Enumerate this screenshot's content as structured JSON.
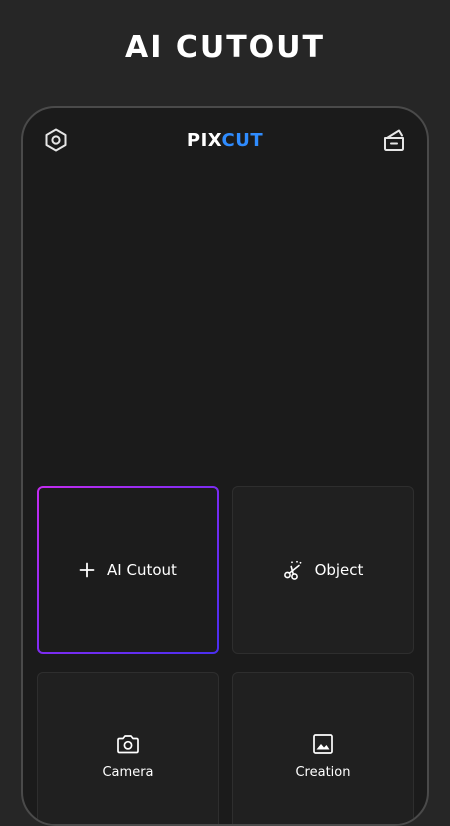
{
  "headline": "AI CUTOUT",
  "app": {
    "logo_left": "PIX",
    "logo_right": "CUT"
  },
  "icons": {
    "settings": "hexagon-settings-icon",
    "cart": "cart-icon",
    "plus": "plus-icon",
    "scissors": "scissors-icon",
    "camera": "camera-icon",
    "image": "image-icon"
  },
  "cards": {
    "ai_cutout": "AI Cutout",
    "object": "Object",
    "camera": "Camera",
    "creation": "Creation"
  },
  "colors": {
    "accent_blue": "#2f8cff",
    "selected_gradient_start": "#c42cf0",
    "selected_gradient_end": "#4a2ff0"
  }
}
